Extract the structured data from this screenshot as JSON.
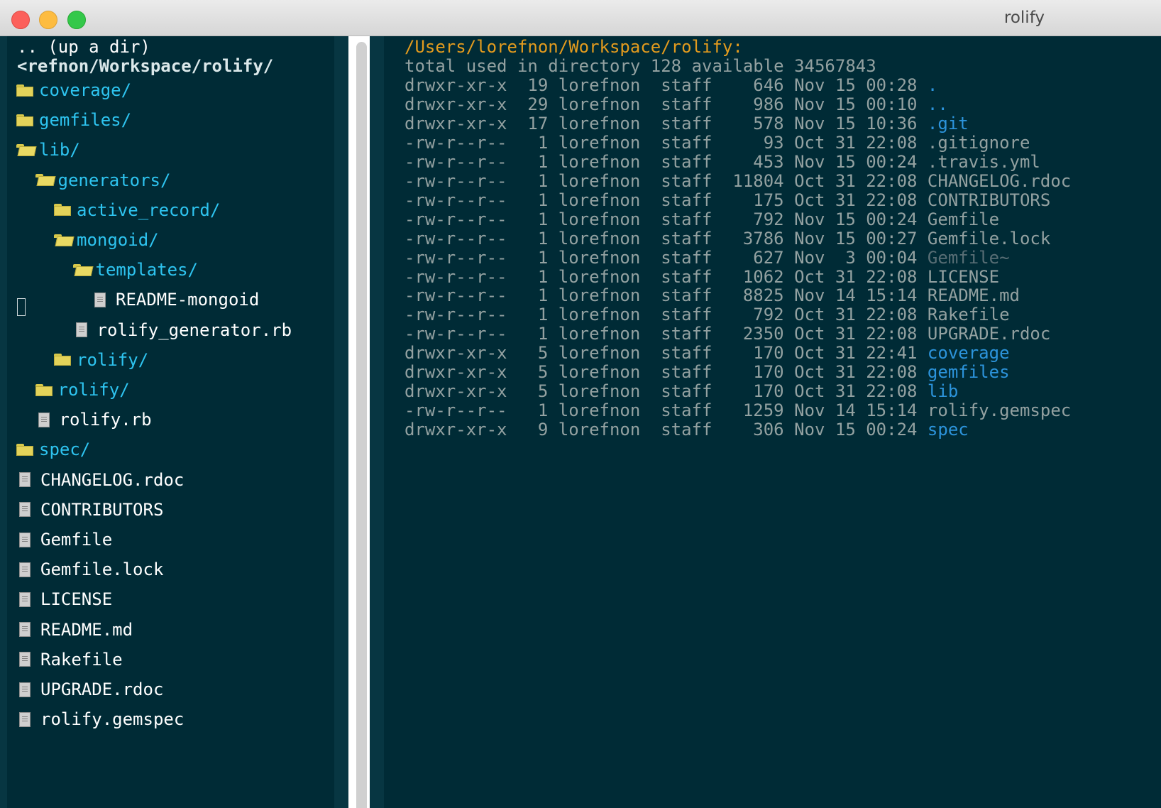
{
  "window": {
    "title": "rolify"
  },
  "tree": {
    "up_dir": ".. (up a dir)",
    "path": "<refnon/Workspace/rolify/",
    "items": [
      {
        "label": "coverage/",
        "type": "dir",
        "open": false
      },
      {
        "label": "gemfiles/",
        "type": "dir",
        "open": false
      },
      {
        "label": "lib/",
        "type": "dir",
        "open": true
      },
      {
        "label": "generators/",
        "type": "dir",
        "open": true
      },
      {
        "label": "active_record/",
        "type": "dir",
        "open": false
      },
      {
        "label": "mongoid/",
        "type": "dir",
        "open": true
      },
      {
        "label": "templates/",
        "type": "dir",
        "open": true
      },
      {
        "label": "README-mongoid",
        "type": "file"
      },
      {
        "label": "rolify_generator.rb",
        "type": "file"
      },
      {
        "label": "rolify/",
        "type": "dir",
        "open": false
      },
      {
        "label": "rolify/",
        "type": "dir",
        "open": false
      },
      {
        "label": "rolify.rb",
        "type": "file"
      },
      {
        "label": "spec/",
        "type": "dir",
        "open": false
      },
      {
        "label": "CHANGELOG.rdoc",
        "type": "file"
      },
      {
        "label": "CONTRIBUTORS",
        "type": "file"
      },
      {
        "label": "Gemfile",
        "type": "file"
      },
      {
        "label": "Gemfile.lock",
        "type": "file"
      },
      {
        "label": "LICENSE",
        "type": "file"
      },
      {
        "label": "README.md",
        "type": "file"
      },
      {
        "label": "Rakefile",
        "type": "file"
      },
      {
        "label": "UPGRADE.rdoc",
        "type": "file"
      },
      {
        "label": "rolify.gemspec",
        "type": "file"
      }
    ]
  },
  "listing": {
    "path": "/Users/lorefnon/Workspace/rolify:",
    "summary": "total used in directory 128 available 34567843",
    "entries": [
      {
        "prefix": "drwxr-xr-x  19 lorefnon  staff    646 Nov 15 00:28 ",
        "name": ".",
        "kind": "dir"
      },
      {
        "prefix": "drwxr-xr-x  29 lorefnon  staff    986 Nov 15 00:10 ",
        "name": "..",
        "kind": "dir"
      },
      {
        "prefix": "drwxr-xr-x  17 lorefnon  staff    578 Nov 15 10:36 ",
        "name": ".git",
        "kind": "dir"
      },
      {
        "prefix": "-rw-r--r--   1 lorefnon  staff     93 Oct 31 22:08 ",
        "name": ".gitignore",
        "kind": "file"
      },
      {
        "prefix": "-rw-r--r--   1 lorefnon  staff    453 Nov 15 00:24 ",
        "name": ".travis.yml",
        "kind": "file"
      },
      {
        "prefix": "-rw-r--r--   1 lorefnon  staff  11804 Oct 31 22:08 ",
        "name": "CHANGELOG.rdoc",
        "kind": "file"
      },
      {
        "prefix": "-rw-r--r--   1 lorefnon  staff    175 Oct 31 22:08 ",
        "name": "CONTRIBUTORS",
        "kind": "file"
      },
      {
        "prefix": "-rw-r--r--   1 lorefnon  staff    792 Nov 15 00:24 ",
        "name": "Gemfile",
        "kind": "file"
      },
      {
        "prefix": "-rw-r--r--   1 lorefnon  staff   3786 Nov 15 00:27 ",
        "name": "Gemfile.lock",
        "kind": "file"
      },
      {
        "prefix": "-rw-r--r--   1 lorefnon  staff    627 Nov  3 00:04 ",
        "name": "Gemfile~",
        "kind": "backup"
      },
      {
        "prefix": "-rw-r--r--   1 lorefnon  staff   1062 Oct 31 22:08 ",
        "name": "LICENSE",
        "kind": "file"
      },
      {
        "prefix": "-rw-r--r--   1 lorefnon  staff   8825 Nov 14 15:14 ",
        "name": "README.md",
        "kind": "file"
      },
      {
        "prefix": "-rw-r--r--   1 lorefnon  staff    792 Oct 31 22:08 ",
        "name": "Rakefile",
        "kind": "file"
      },
      {
        "prefix": "-rw-r--r--   1 lorefnon  staff   2350 Oct 31 22:08 ",
        "name": "UPGRADE.rdoc",
        "kind": "file"
      },
      {
        "prefix": "drwxr-xr-x   5 lorefnon  staff    170 Oct 31 22:41 ",
        "name": "coverage",
        "kind": "dir"
      },
      {
        "prefix": "drwxr-xr-x   5 lorefnon  staff    170 Oct 31 22:08 ",
        "name": "gemfiles",
        "kind": "dir"
      },
      {
        "prefix": "drwxr-xr-x   5 lorefnon  staff    170 Oct 31 22:08 ",
        "name": "lib",
        "kind": "dir"
      },
      {
        "prefix": "-rw-r--r--   1 lorefnon  staff   1259 Nov 14 15:14 ",
        "name": "rolify.gemspec",
        "kind": "file"
      },
      {
        "prefix": "drwxr-xr-x   9 lorefnon  staff    306 Nov 15 00:24 ",
        "name": "spec",
        "kind": "dir"
      }
    ]
  }
}
